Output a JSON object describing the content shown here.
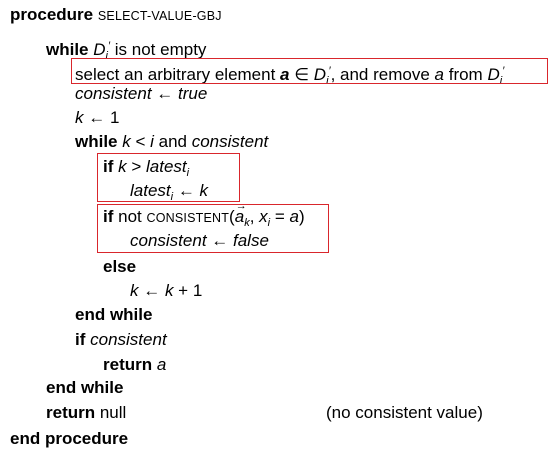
{
  "lines": {
    "l0": {
      "kw": "procedure",
      "name": "SELECT-VALUE-GBJ"
    },
    "l1": {
      "kw": "while",
      "var": "D",
      "sub": "i",
      "sup": "′",
      "rest": " is not empty"
    },
    "l2": {
      "t1": "select an arbitrary element ",
      "a": "a",
      "in": " ∈ ",
      "D": "D",
      "sub": "i",
      "sup": "′",
      "t2": ", and remove ",
      "a2": "a",
      "t3": " from ",
      "D2": "D",
      "sub2": "i",
      "sup2": "′"
    },
    "l3": {
      "text": "consistent ← true"
    },
    "l4": {
      "k": "k",
      "rest": " ← 1"
    },
    "l5": {
      "kw": "while",
      "k": "k",
      "lt": " < ",
      "i": "i",
      "and": " and ",
      "consistent": "consistent"
    },
    "l6": {
      "kw": "if",
      "k": "k",
      "gt": " > ",
      "latest": "latest",
      "sub": "i"
    },
    "l7": {
      "latest": "latest",
      "sub": "i",
      "arrow": " ← ",
      "k": "k"
    },
    "l8": {
      "kw": "if",
      "not": " not ",
      "fn": "CONSISTENT",
      "open": "(",
      "a": "a",
      "asub": "k",
      "comma": ", ",
      "x": "x",
      "xsub": "i",
      "eq": " = ",
      "a2": "a",
      "close": ")"
    },
    "l9": {
      "text": "consistent ← false"
    },
    "l10": {
      "kw": "else"
    },
    "l11": {
      "k": "k",
      "arrow": " ← ",
      "k2": "k",
      "plus": " + 1"
    },
    "l12": {
      "kw": "end while"
    },
    "l13": {
      "kw": "if",
      "cond": "consistent"
    },
    "l14": {
      "kw": "return",
      "a": "a"
    },
    "l15": {
      "kw": "end while"
    },
    "l16": {
      "kw": "return",
      "rest": " null"
    },
    "l17": {
      "kw": "end procedure"
    }
  },
  "comment": "(no consistent value)",
  "highlight_color": "#d9262c"
}
